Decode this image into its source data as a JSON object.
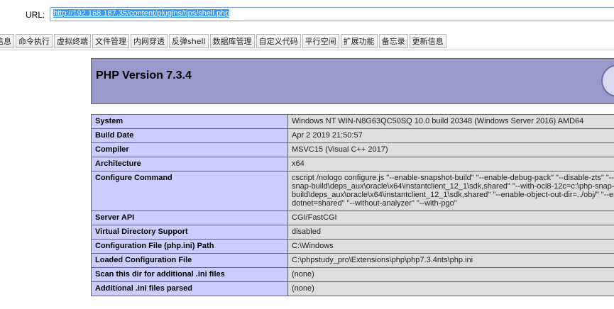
{
  "urlbar": {
    "label": "URL:",
    "value": "http://192.168.187.35/content/plugins/tips/shell.php"
  },
  "tabs": [
    {
      "label": "信息"
    },
    {
      "label": "命令执行"
    },
    {
      "label": "虚拟终端"
    },
    {
      "label": "文件管理"
    },
    {
      "label": "内网穿透"
    },
    {
      "label": "反弹shell"
    },
    {
      "label": "数据库管理"
    },
    {
      "label": "自定义代码"
    },
    {
      "label": "平行空间"
    },
    {
      "label": "扩展功能"
    },
    {
      "label": "备忘录"
    },
    {
      "label": "更新信息"
    }
  ],
  "phpinfo": {
    "title": "PHP Version 7.3.4",
    "logo_icon": "php-logo-icon",
    "rows": [
      {
        "key": "System",
        "value": "Windows NT WIN-N8G63QC50SQ 10.0 build 20348 (Windows Server 2016) AMD64"
      },
      {
        "key": "Build Date",
        "value": "Apr 2 2019 21:50:57"
      },
      {
        "key": "Compiler",
        "value": "MSVC15 (Visual C++ 2017)"
      },
      {
        "key": "Architecture",
        "value": "x64"
      },
      {
        "key": "Configure Command",
        "value": "cscript /nologo configure.js \"--enable-snapshot-build\" \"--enable-debug-pack\" \"--disable-zts\" \"--wit\nsnap-build\\deps_aux\\oracle\\x64\\instantclient_12_1\\sdk,shared\" \"--with-oci8-12c=c:\\php-snap-\nbuild\\deps_aux\\oracle\\x64\\instantclient_12_1\\sdk,shared\" \"--enable-object-out-dir=../obj/\" \"--enab\ndotnet=shared\" \"--without-analyzer\" \"--with-pgo\""
      },
      {
        "key": "Server API",
        "value": "CGI/FastCGI"
      },
      {
        "key": "Virtual Directory Support",
        "value": "disabled"
      },
      {
        "key": "Configuration File (php.ini) Path",
        "value": "C:\\Windows"
      },
      {
        "key": "Loaded Configuration File",
        "value": "C:\\phpstudy_pro\\Extensions\\php\\php7.3.4nts\\php.ini"
      },
      {
        "key": "Scan this dir for additional .ini files",
        "value": "(none)"
      },
      {
        "key": "Additional .ini files parsed",
        "value": "(none)"
      }
    ]
  }
}
